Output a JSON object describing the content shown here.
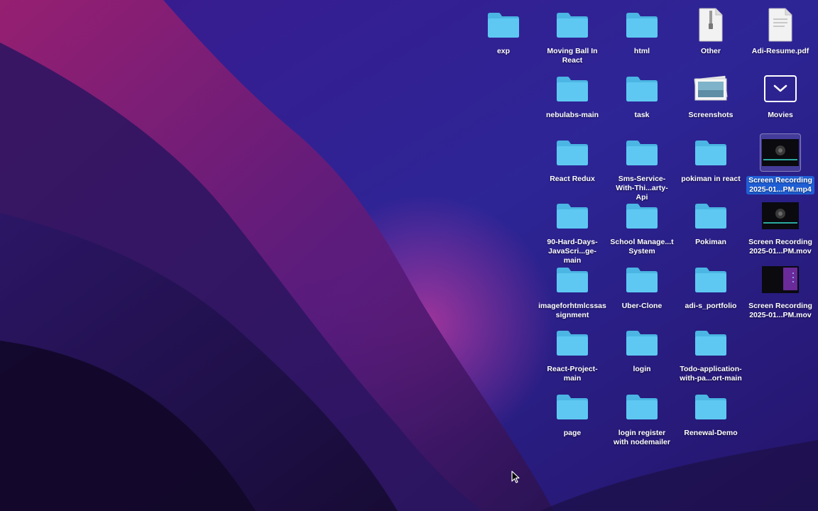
{
  "desktop": {
    "icons": [
      {
        "label": "exp",
        "kind": "folder-icon"
      },
      {
        "label": "Moving Ball In React",
        "kind": "folder-icon"
      },
      {
        "label": "html",
        "kind": "folder-icon"
      },
      {
        "label": "Other",
        "kind": "zip-file-icon",
        "badge": "ZIP"
      },
      {
        "label": "Adi-Resume.pdf",
        "kind": "pdf-file-icon",
        "badge": "PDF"
      },
      {
        "label": "nebulabs-main",
        "kind": "folder-icon"
      },
      {
        "label": "task",
        "kind": "folder-icon"
      },
      {
        "label": "Screenshots",
        "kind": "image-stack-icon"
      },
      {
        "label": "Movies",
        "kind": "movies-folder-icon"
      },
      {
        "label": "React Redux",
        "kind": "folder-icon"
      },
      {
        "label": "Sms-Service-With-Thi...arty-Api",
        "kind": "folder-icon"
      },
      {
        "label": "pokiman in react",
        "kind": "folder-icon"
      },
      {
        "label": "Screen Recording 2025-01...PM.mp4",
        "kind": "video-thumbnail-icon",
        "selected": true
      },
      {
        "label": "90-Hard-Days-JavaScri...ge-main",
        "kind": "folder-icon"
      },
      {
        "label": "School Manage...t System",
        "kind": "folder-icon"
      },
      {
        "label": "Pokiman",
        "kind": "folder-icon"
      },
      {
        "label": "Screen Recording 2025-01...PM.mov",
        "kind": "video-thumbnail-icon"
      },
      {
        "label": "imageforhtmlcssassignment",
        "kind": "folder-icon"
      },
      {
        "label": "Uber-Clone",
        "kind": "folder-icon"
      },
      {
        "label": "adi-s_portfolio",
        "kind": "folder-icon"
      },
      {
        "label": "Screen Recording 2025-01...PM.mov",
        "kind": "video-thumbnail-icon"
      },
      {
        "label": "React-Project-main",
        "kind": "folder-icon"
      },
      {
        "label": "login",
        "kind": "folder-icon"
      },
      {
        "label": "Todo-application-with-pa...ort-main",
        "kind": "folder-icon"
      },
      {
        "label": "page",
        "kind": "folder-icon"
      },
      {
        "label": "login register with nodemailer",
        "kind": "folder-icon"
      },
      {
        "label": "Renewal-Demo",
        "kind": "folder-icon"
      }
    ]
  },
  "colors": {
    "folder": "#5ec8f2",
    "folder_tab": "#4bb6e3",
    "selection": "#1f5fd6"
  }
}
